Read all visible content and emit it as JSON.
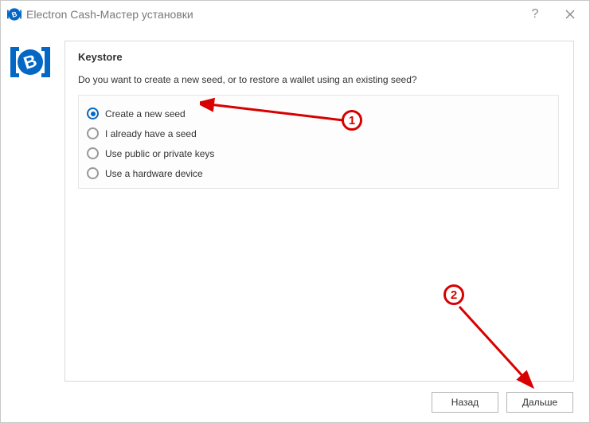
{
  "titlebar": {
    "app_name": "Electron Cash",
    "separator": "  -  ",
    "subtitle": "Мастер установки"
  },
  "panel": {
    "heading": "Keystore",
    "prompt": "Do you want to create a new seed, or to restore a wallet using an existing seed?"
  },
  "options": [
    {
      "label": "Create a new seed",
      "selected": true
    },
    {
      "label": "I already have a seed",
      "selected": false
    },
    {
      "label": "Use public or private keys",
      "selected": false
    },
    {
      "label": "Use a hardware device",
      "selected": false
    }
  ],
  "buttons": {
    "back": "Назад",
    "next": "Дальше"
  },
  "annotations": {
    "marker1": "1",
    "marker2": "2"
  },
  "colors": {
    "brand": "#0467c6",
    "annotation": "#d80000"
  }
}
